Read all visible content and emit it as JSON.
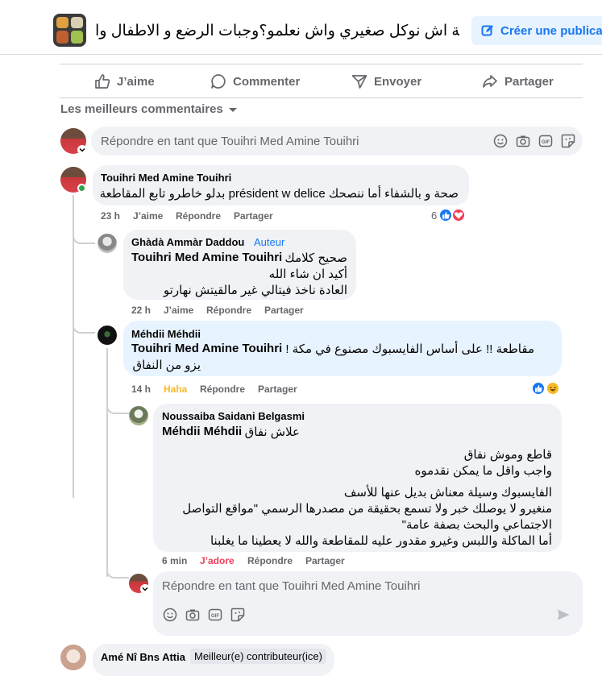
{
  "header": {
    "group_title": "زعمة اش نوكل صغيري واش نعلمو؟وجبات الرضع و الاطفال وا...",
    "create_post_label": "Créer une publicat"
  },
  "actions": {
    "like": "J’aime",
    "comment": "Commenter",
    "send": "Envoyer",
    "share": "Partager"
  },
  "sort_label": "Les meilleurs commentaires",
  "composer": {
    "placeholder": "Répondre en tant que Touihri Med Amine Touihri"
  },
  "comments": [
    {
      "author": "Touihri Med Amine Touihri",
      "text": "صحة و بالشفاء أما ننصحك président w delice بدلو خاطرو تابع المقاطعة",
      "time": "23 h",
      "like_label": "J’aime",
      "reply_label": "Répondre",
      "share_label": "Partager",
      "reaction_count": "6"
    },
    {
      "author": "Ghàdà Ammàr Daddou",
      "badge": "Auteur",
      "mention": "Touihri Med Amine Touihri",
      "lines": [
        "صحيح كلامك",
        "أكيد ان شاء الله",
        "العادة ناخذ فيتالي غير مالقيتش نهارتو"
      ],
      "time": "22 h",
      "like_label": "J’aime",
      "reply_label": "Répondre",
      "share_label": "Partager"
    },
    {
      "author": "Méhdii Méhdii",
      "mention": "Touihri Med Amine Touihri",
      "lines": [
        "مقاطعة !! على أساس الفايسبوك مصنوع في مكة !",
        "يزو من النفاق"
      ],
      "time": "14 h",
      "like_label": "Haha",
      "reply_label": "Répondre",
      "share_label": "Partager"
    },
    {
      "author": "Noussaiba Saidani Belgasmi",
      "mention": "Méhdii Méhdii",
      "lines": [
        "علاش نفاق",
        "قاطع وموش نفاق",
        "واجب واقل ما يمكن نقدموه",
        "الفايسبوك وسيلة معناش بديل عنها للأسف",
        "منغيرو لا يوصلك خبر ولا تسمع بحقيقة من مصدرها الرسمي \"مواقع التواصل",
        "الاجتماعي والبحث بصفة عامة\"",
        "أما الماكلة واللبس وغيرو مقدور عليه للمقاطعة والله لا يعطينا ما يغلبنا"
      ],
      "time": "6 min",
      "like_label": "J’adore",
      "reply_label": "Répondre",
      "share_label": "Partager"
    },
    {
      "author": "Amé Nî Bns Attia",
      "badge": "Meilleur(e) contributeur(ice)"
    }
  ],
  "colors": {
    "accent": "#1877f2",
    "bubble": "#f0f2f5",
    "highlight_bubble": "#e7f3ff",
    "secondary_text": "#65676b",
    "haha": "#f7b928",
    "love": "#f33e58"
  }
}
